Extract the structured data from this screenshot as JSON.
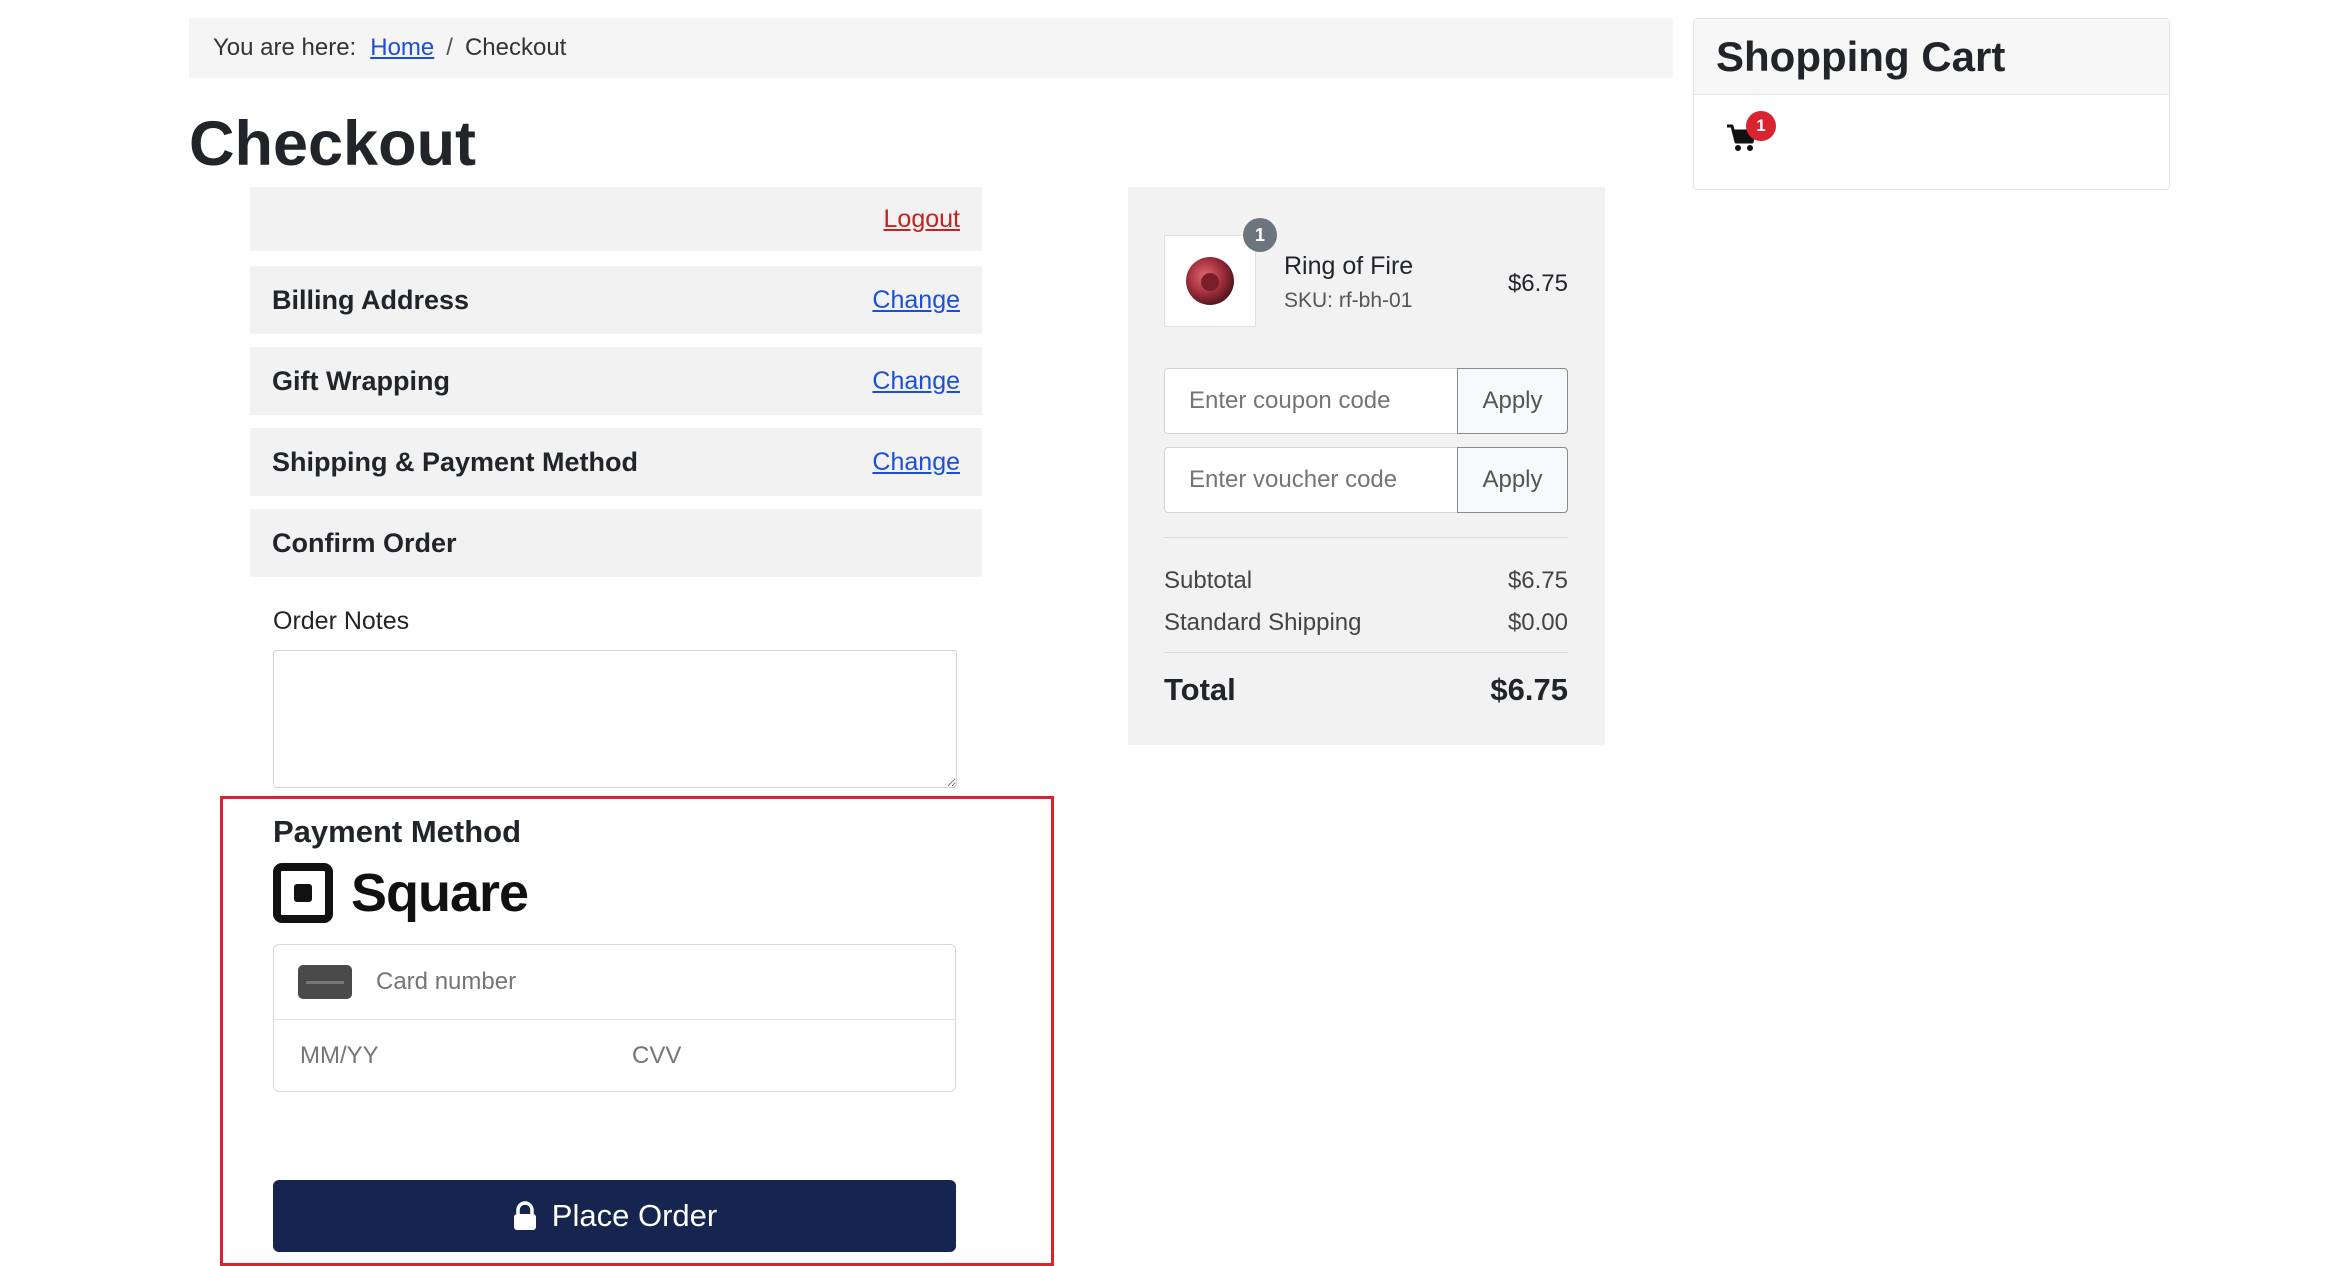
{
  "breadcrumb": {
    "prefix": "You are here:",
    "home": "Home",
    "separator": "/",
    "current": "Checkout"
  },
  "page_title": "Checkout",
  "steps": {
    "logout": "Logout",
    "billing": {
      "title": "Billing Address",
      "action": "Change"
    },
    "gift": {
      "title": "Gift Wrapping",
      "action": "Change"
    },
    "shipping": {
      "title": "Shipping & Payment Method",
      "action": "Change"
    },
    "confirm": {
      "title": "Confirm Order"
    }
  },
  "order_notes": {
    "label": "Order Notes",
    "value": ""
  },
  "payment": {
    "title": "Payment Method",
    "provider": "Square",
    "card_number_placeholder": "Card number",
    "expiry_placeholder": "MM/YY",
    "cvv_placeholder": "CVV",
    "place_order": "Place Order"
  },
  "summary": {
    "item": {
      "qty": "1",
      "name": "Ring of Fire",
      "sku_label": "SKU:",
      "sku": "rf-bh-01",
      "price": "$6.75"
    },
    "coupon": {
      "placeholder": "Enter coupon code",
      "button": "Apply"
    },
    "voucher": {
      "placeholder": "Enter voucher code",
      "button": "Apply"
    },
    "subtotal": {
      "label": "Subtotal",
      "value": "$6.75"
    },
    "shipping": {
      "label": "Standard Shipping",
      "value": "$0.00"
    },
    "total": {
      "label": "Total",
      "value": "$6.75"
    }
  },
  "cart": {
    "title": "Shopping Cart",
    "count": "1"
  },
  "colors": {
    "accent_button": "#15254f",
    "highlight_border": "#d9232e",
    "link": "#1a4fd6",
    "logout_link": "#c5221f"
  },
  "icons": [
    "card-icon",
    "lock-icon",
    "cart-icon",
    "square-logo-icon"
  ]
}
